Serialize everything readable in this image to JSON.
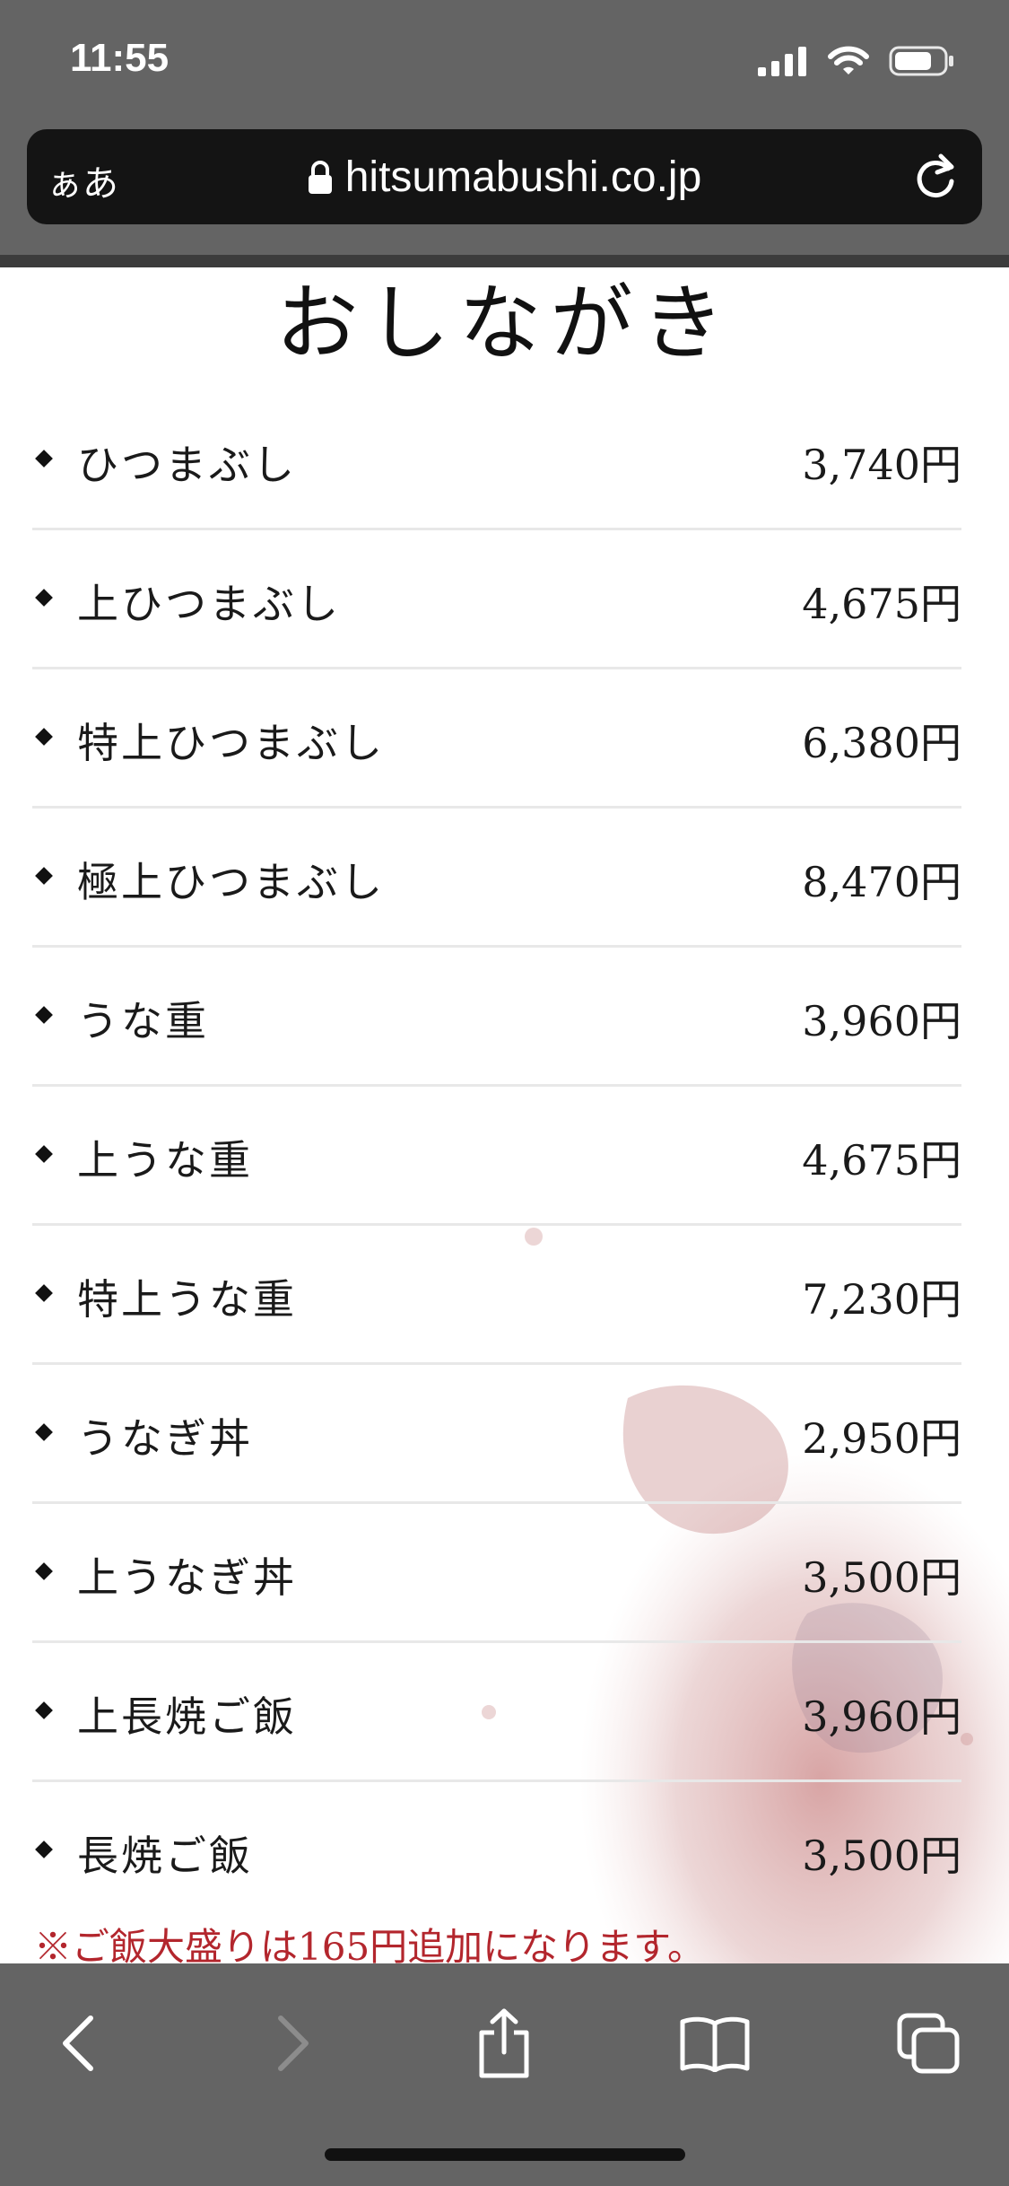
{
  "status_bar": {
    "time": "11:55"
  },
  "browser": {
    "text_size_label": "ぁあ",
    "url": "hitsumabushi.co.jp"
  },
  "page": {
    "title": "おしながき",
    "menu_items": [
      {
        "name": "ひつまぶし",
        "price": "3,740円"
      },
      {
        "name": "上ひつまぶし",
        "price": "4,675円"
      },
      {
        "name": "特上ひつまぶし",
        "price": "6,380円"
      },
      {
        "name": "極上ひつまぶし",
        "price": "8,470円"
      },
      {
        "name": "うな重",
        "price": "3,960円"
      },
      {
        "name": "上うな重",
        "price": "4,675円"
      },
      {
        "name": "特上うな重",
        "price": "7,230円"
      },
      {
        "name": "うなぎ丼",
        "price": "2,950円"
      },
      {
        "name": "上うなぎ丼",
        "price": "3,500円"
      },
      {
        "name": "上長焼ご飯",
        "price": "3,960円"
      },
      {
        "name": "長焼ご飯",
        "price": "3,500円"
      }
    ],
    "note": "※ご飯大盛りは165円追加になります。"
  },
  "toolbar": {
    "icons": [
      "back-icon",
      "forward-icon",
      "share-icon",
      "bookmarks-icon",
      "tabs-icon"
    ]
  },
  "colors": {
    "chrome": "#646464",
    "address_bar": "#141414",
    "note_red": "#b3262d",
    "splash": "#c98a8a"
  }
}
